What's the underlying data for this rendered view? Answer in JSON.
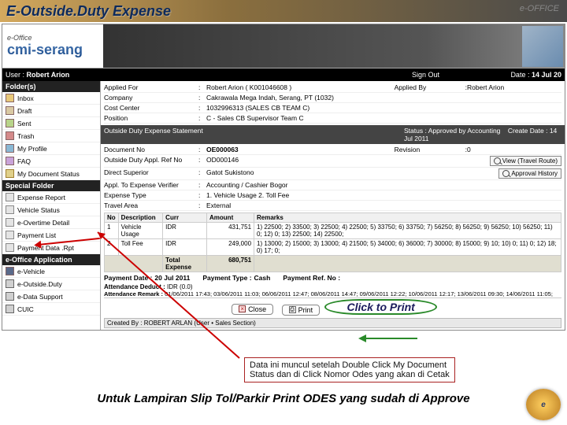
{
  "title": "E-Outside.Duty Expense",
  "brand_right": "e-OFFICE",
  "header": {
    "small": "e-Office",
    "app_name": "cmi-serang",
    "user_lbl": "User :",
    "user_val": "Robert Arion",
    "signout": "Sign Out",
    "date_lbl": "Date :",
    "date_val": "14 Jul 20"
  },
  "sidebar": {
    "h1": "Folder(s)",
    "s1": [
      "Inbox",
      "Draft",
      "Sent",
      "Trash",
      "My Profile",
      "FAQ",
      "My Document Status"
    ],
    "h2": "Special Folder",
    "s2": [
      "Expense Report",
      "Vehicle Status",
      "e-Overtime Detail",
      "Payment List",
      "Payment Data .Rpt"
    ],
    "h3": "e-Office Application",
    "s3": [
      "e-Vehicle",
      "e-Outside.Duty",
      "e-Data Support",
      "CUIC"
    ]
  },
  "info": {
    "r0": {
      "l": "Applied For",
      "v": "Robert Arion ( K001046608 )",
      "l2": "Applied By",
      "v2": "Robert Arion"
    },
    "r1": {
      "l": "Company",
      "v": "Cakrawala Mega Indah, Serang, PT (1032)"
    },
    "r2": {
      "l": "Cost Center",
      "v": "1032996313 (SALES CB TEAM C)"
    },
    "r3": {
      "l": "Position",
      "v": "C - Sales CB Supervisor Team C"
    }
  },
  "sec": {
    "title": "Outside Duty Expense Statement",
    "status_l": "Status :",
    "status_v": "Approved by Accounting",
    "create_l": "Create Date :",
    "create_v": "14 Jul 2011"
  },
  "info2": {
    "r0": {
      "l": "Document No",
      "v": "OE000063",
      "l2": "Revision",
      "v2": "0"
    },
    "r1": {
      "l": "Outside Duty Appl. Ref No",
      "v": "OD000146"
    },
    "r2": {
      "l": "Direct Superior",
      "v": "Gatot Sukistono"
    },
    "r3": {
      "l": "Appl. To Expense Verifier",
      "v": "Accounting / Cashier Bogor"
    },
    "r4": {
      "l": "Expense Type",
      "v": "1. Vehicle Usage   2. Toll Fee"
    },
    "r5": {
      "l": "Travel Area",
      "v": "External"
    }
  },
  "btns": {
    "view": "View (Travel Route)",
    "hist": "Approval History",
    "close": "Close",
    "print": "Print"
  },
  "tbl": {
    "h": [
      "No",
      "Description",
      "Curr",
      "Amount",
      "Remarks"
    ],
    "r": [
      [
        "1",
        "Vehicle Usage",
        "IDR",
        "431,751",
        "1) 22500; 2) 33500; 3) 22500; 4) 22500; 5) 33750; 6) 33750; 7) 56250; 8) 56250; 9) 56250; 10) 56250; 11) 0; 12) 0; 13) 22500; 14) 22500;"
      ],
      [
        "2",
        "Toll Fee",
        "IDR",
        "249,000",
        "1) 13000; 2) 15000; 3) 13000; 4) 21500; 5) 34000; 6) 36000; 7) 30000; 8) 15000; 9) 10; 10) 0; 11) 0; 12) 18; 0) 17; 0;"
      ]
    ],
    "tot": {
      "l": "Total Expense",
      "v": "680,751"
    }
  },
  "pay": {
    "d_l": "Payment Date :",
    "d_v": "20 Jul 2011",
    "t_l": "Payment Type :",
    "t_v": "Cash",
    "r_l": "Payment Ref. No :",
    "r_v": ""
  },
  "att": {
    "l1": "Attendance Deduct :",
    "v1": "IDR (0.0)",
    "l2": "Attendance Remark :",
    "v2": "01/06/2011 17:43; 03/06/2011 11:03; 06/06/2011 12:47; 08/06/2011 14:47; 09/06/2011 12:22; 10/06/2011 12:17; 13/06/2011 09:30; 14/06/2011 11:05;"
  },
  "created": {
    "l": "Created By :",
    "v": "ROBERT ARLAN (User • Sales Section)"
  },
  "annot": {
    "click_print": "Click to Print",
    "callout1": "Data ini muncul setelah Double Click My Document",
    "callout2": "Status dan di Click Nomor Odes yang akan di Cetak",
    "bottom": "Untuk Lampiran Slip Tol/Parkir Print ODES yang sudah di Approve"
  }
}
